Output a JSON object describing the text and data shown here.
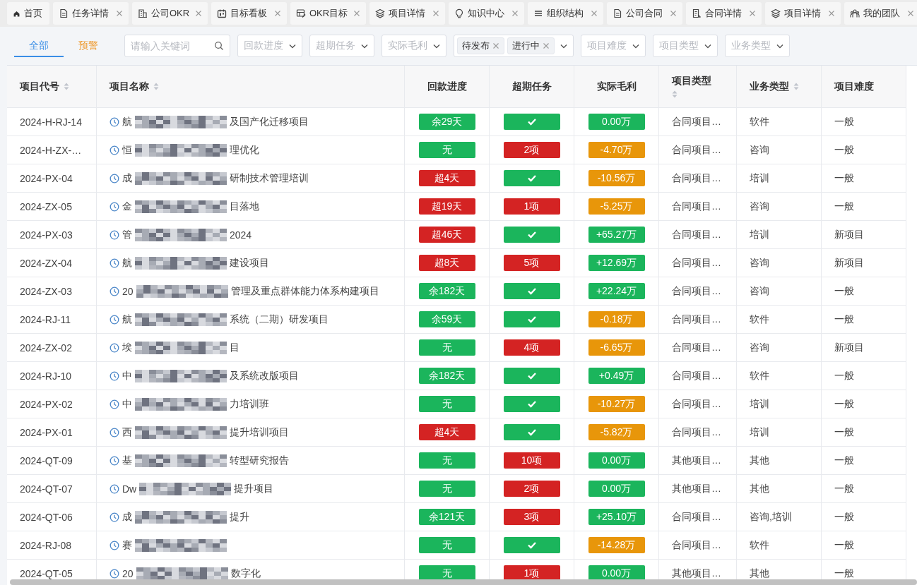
{
  "tabs": [
    {
      "label": "首页",
      "closable": false
    },
    {
      "label": "任务详情",
      "closable": true
    },
    {
      "label": "公司OKR",
      "closable": true
    },
    {
      "label": "目标看板",
      "closable": true
    },
    {
      "label": "OKR目标",
      "closable": true
    },
    {
      "label": "项目详情",
      "closable": true
    },
    {
      "label": "知识中心",
      "closable": true
    },
    {
      "label": "组织结构",
      "closable": true
    },
    {
      "label": "公司合同",
      "closable": true
    },
    {
      "label": "合同详情",
      "closable": true
    },
    {
      "label": "项目详情",
      "closable": true
    },
    {
      "label": "我的团队",
      "closable": true
    }
  ],
  "filter_tabs": [
    {
      "label": "全部",
      "kind": "normal",
      "selected": true
    },
    {
      "label": "预警",
      "kind": "warning",
      "selected": false
    }
  ],
  "search": {
    "placeholder": "请输入关键词"
  },
  "filters_left": [
    {
      "placeholder": "回款进度"
    },
    {
      "placeholder": "超期任务"
    },
    {
      "placeholder": "实际毛利"
    }
  ],
  "status_filter": {
    "tags": [
      "待发布",
      "进行中"
    ]
  },
  "filters_right": [
    {
      "placeholder": "项目难度"
    },
    {
      "placeholder": "项目类型"
    },
    {
      "placeholder": "业务类型"
    }
  ],
  "table": {
    "columns": [
      {
        "label": "项目代号",
        "sortable": true
      },
      {
        "label": "项目名称",
        "sortable": true
      },
      {
        "label": "回款进度",
        "sortable": false
      },
      {
        "label": "超期任务",
        "sortable": false
      },
      {
        "label": "实际毛利",
        "sortable": false
      },
      {
        "label": "项目类型",
        "sortable": true
      },
      {
        "label": "业务类型",
        "sortable": true
      },
      {
        "label": "项目难度",
        "sortable": false
      }
    ],
    "rows": [
      {
        "code": "2024-H-RJ-14",
        "name_start": "航",
        "redacted": true,
        "name_end": "及国产化迁移项目",
        "payment": {
          "text": "余29天",
          "color": "#1bb55c"
        },
        "overdue": {
          "kind": "check",
          "color": "#1bb55c"
        },
        "margin": {
          "text": "0.00万",
          "color": "#1bb55c"
        },
        "project_type": "合同项目…",
        "business_type": "软件",
        "difficulty": "一般"
      },
      {
        "code": "2024-H-ZX-…",
        "name_start": "恒",
        "redacted": true,
        "name_end": "理优化",
        "payment": {
          "text": "无",
          "color": "#1bb55c"
        },
        "overdue": {
          "kind": "text",
          "text": "2项",
          "color": "#d42323"
        },
        "margin": {
          "text": "-4.70万",
          "color": "#e8960a"
        },
        "project_type": "合同项目…",
        "business_type": "咨询",
        "difficulty": "一般"
      },
      {
        "code": "2024-PX-04",
        "name_start": "成",
        "redacted": true,
        "name_end": "研制技术管理培训",
        "payment": {
          "text": "超4天",
          "color": "#d42323"
        },
        "overdue": {
          "kind": "check",
          "color": "#1bb55c"
        },
        "margin": {
          "text": "-10.56万",
          "color": "#e8960a"
        },
        "project_type": "合同项目…",
        "business_type": "培训",
        "difficulty": "一般"
      },
      {
        "code": "2024-ZX-05",
        "name_start": "金",
        "redacted": true,
        "name_end": "目落地",
        "payment": {
          "text": "超19天",
          "color": "#d42323"
        },
        "overdue": {
          "kind": "text",
          "text": "1项",
          "color": "#d42323"
        },
        "margin": {
          "text": "-5.25万",
          "color": "#e8960a"
        },
        "project_type": "合同项目…",
        "business_type": "咨询",
        "difficulty": "一般"
      },
      {
        "code": "2024-PX-03",
        "name_start": "管",
        "redacted": true,
        "name_end": "2024",
        "payment": {
          "text": "超46天",
          "color": "#d42323"
        },
        "overdue": {
          "kind": "check",
          "color": "#1bb55c"
        },
        "margin": {
          "text": "+65.27万",
          "color": "#1bb55c"
        },
        "project_type": "合同项目…",
        "business_type": "培训",
        "difficulty": "新项目"
      },
      {
        "code": "2024-ZX-04",
        "name_start": "航",
        "redacted": true,
        "name_end": "建设项目",
        "payment": {
          "text": "超8天",
          "color": "#d42323"
        },
        "overdue": {
          "kind": "text",
          "text": "5项",
          "color": "#d42323"
        },
        "margin": {
          "text": "+12.69万",
          "color": "#1bb55c"
        },
        "project_type": "合同项目…",
        "business_type": "咨询",
        "difficulty": "新项目"
      },
      {
        "code": "2024-ZX-03",
        "name_start": "20",
        "redacted": true,
        "name_end": "管理及重点群体能力体系构建项目",
        "payment": {
          "text": "余182天",
          "color": "#1bb55c"
        },
        "overdue": {
          "kind": "check",
          "color": "#1bb55c"
        },
        "margin": {
          "text": "+22.24万",
          "color": "#1bb55c"
        },
        "project_type": "合同项目…",
        "business_type": "咨询",
        "difficulty": "一般"
      },
      {
        "code": "2024-RJ-11",
        "name_start": "航",
        "redacted": true,
        "name_end": "系统（二期）研发项目",
        "payment": {
          "text": "余59天",
          "color": "#1bb55c"
        },
        "overdue": {
          "kind": "check",
          "color": "#1bb55c"
        },
        "margin": {
          "text": "-0.18万",
          "color": "#e8960a"
        },
        "project_type": "合同项目…",
        "business_type": "软件",
        "difficulty": "一般"
      },
      {
        "code": "2024-ZX-02",
        "name_start": "埃",
        "redacted": true,
        "name_end": "目",
        "payment": {
          "text": "无",
          "color": "#1bb55c"
        },
        "overdue": {
          "kind": "text",
          "text": "4项",
          "color": "#d42323"
        },
        "margin": {
          "text": "-6.65万",
          "color": "#e8960a"
        },
        "project_type": "合同项目…",
        "business_type": "咨询",
        "difficulty": "新项目"
      },
      {
        "code": "2024-RJ-10",
        "name_start": "中",
        "redacted": true,
        "name_end": "及系统改版项目",
        "payment": {
          "text": "余182天",
          "color": "#1bb55c"
        },
        "overdue": {
          "kind": "check",
          "color": "#1bb55c"
        },
        "margin": {
          "text": "+0.49万",
          "color": "#1bb55c"
        },
        "project_type": "合同项目…",
        "business_type": "软件",
        "difficulty": "一般"
      },
      {
        "code": "2024-PX-02",
        "name_start": "中",
        "redacted": true,
        "name_end": "力培训班",
        "payment": {
          "text": "无",
          "color": "#1bb55c"
        },
        "overdue": {
          "kind": "check",
          "color": "#1bb55c"
        },
        "margin": {
          "text": "-10.27万",
          "color": "#e8960a"
        },
        "project_type": "合同项目…",
        "business_type": "培训",
        "difficulty": "一般"
      },
      {
        "code": "2024-PX-01",
        "name_start": "西",
        "redacted": true,
        "name_end": "提升培训项目",
        "payment": {
          "text": "超4天",
          "color": "#d42323"
        },
        "overdue": {
          "kind": "check",
          "color": "#1bb55c"
        },
        "margin": {
          "text": "-5.82万",
          "color": "#e8960a"
        },
        "project_type": "合同项目…",
        "business_type": "培训",
        "difficulty": "一般"
      },
      {
        "code": "2024-QT-09",
        "name_start": "基",
        "redacted": true,
        "name_end": "转型研究报告",
        "payment": {
          "text": "无",
          "color": "#1bb55c"
        },
        "overdue": {
          "kind": "text",
          "text": "10项",
          "color": "#d42323"
        },
        "margin": {
          "text": "0.00万",
          "color": "#1bb55c"
        },
        "project_type": "其他项目…",
        "business_type": "其他",
        "difficulty": "一般"
      },
      {
        "code": "2024-QT-07",
        "name_start": "Dw",
        "redacted": true,
        "name_end": "提升项目",
        "payment": {
          "text": "无",
          "color": "#1bb55c"
        },
        "overdue": {
          "kind": "text",
          "text": "2项",
          "color": "#d42323"
        },
        "margin": {
          "text": "0.00万",
          "color": "#1bb55c"
        },
        "project_type": "其他项目…",
        "business_type": "其他",
        "difficulty": "一般"
      },
      {
        "code": "2024-QT-06",
        "name_start": "成",
        "redacted": true,
        "name_end": "提升",
        "payment": {
          "text": "余121天",
          "color": "#1bb55c"
        },
        "overdue": {
          "kind": "text",
          "text": "3项",
          "color": "#d42323"
        },
        "margin": {
          "text": "+25.10万",
          "color": "#1bb55c"
        },
        "project_type": "合同项目…",
        "business_type": "咨询,培训",
        "difficulty": "一般"
      },
      {
        "code": "2024-RJ-08",
        "name_start": "赛",
        "redacted": true,
        "payment": {
          "text": "无",
          "color": "#1bb55c"
        },
        "overdue": {
          "kind": "check",
          "color": "#1bb55c"
        },
        "margin": {
          "text": "-14.28万",
          "color": "#e8960a"
        },
        "project_type": "合同项目…",
        "business_type": "软件",
        "difficulty": "一般"
      },
      {
        "code": "2024-QT-05",
        "name_start": "20",
        "redacted": true,
        "name_end": "数字化",
        "payment": {
          "text": "无",
          "color": "#1bb55c"
        },
        "overdue": {
          "kind": "text",
          "text": "1项",
          "color": "#d42323"
        },
        "margin": {
          "text": "0.00万",
          "color": "#1bb55c"
        },
        "project_type": "其他项目…",
        "business_type": "其他",
        "difficulty": "一般"
      }
    ]
  }
}
